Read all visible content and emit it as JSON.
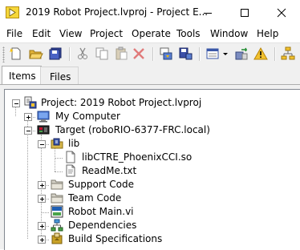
{
  "window": {
    "title": "2019 Robot Project.lvproj - Project E...",
    "controls": [
      "minimize-icon",
      "maximize-icon",
      "close-icon"
    ]
  },
  "menu": [
    "File",
    "Edit",
    "View",
    "Project",
    "Operate",
    "Tools",
    "Window",
    "Help"
  ],
  "toolbar": {
    "buttons": [
      "new-icon",
      "open-icon",
      "save-all-icon",
      "cut-icon",
      "copy-icon",
      "paste-icon",
      "delete-icon",
      "build-icon",
      "save-as-icon",
      "view-icon",
      "dropdown-icon",
      "deploy-icon",
      "warning-icon",
      "hierarchy-icon"
    ]
  },
  "tabs": {
    "items": "Items",
    "files": "Files"
  },
  "tree": {
    "project": "Project: 2019 Robot Project.lvproj",
    "my_computer": "My Computer",
    "target": "Target (roboRIO-6377-FRC.local)",
    "lib": "lib",
    "lib_file1": "libCTRE_PhoenixCCI.so",
    "lib_file2": "ReadMe.txt",
    "support_code": "Support Code",
    "team_code": "Team Code",
    "robot_main": "Robot Main.vi",
    "dependencies": "Dependencies",
    "build_specs": "Build Specifications"
  },
  "colors": {
    "folder": "#c9a227",
    "lib_folder": "#d8b84a",
    "accent": "#1e5fb4",
    "warning": "#f2c12e"
  }
}
